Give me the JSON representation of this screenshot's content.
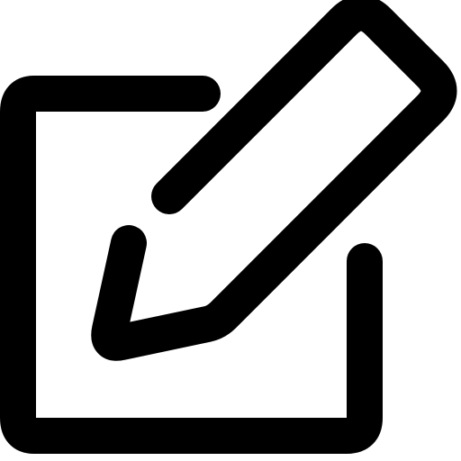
{
  "icon": {
    "name": "edit-icon",
    "stroke_color": "#000000",
    "background": "#ffffff"
  }
}
